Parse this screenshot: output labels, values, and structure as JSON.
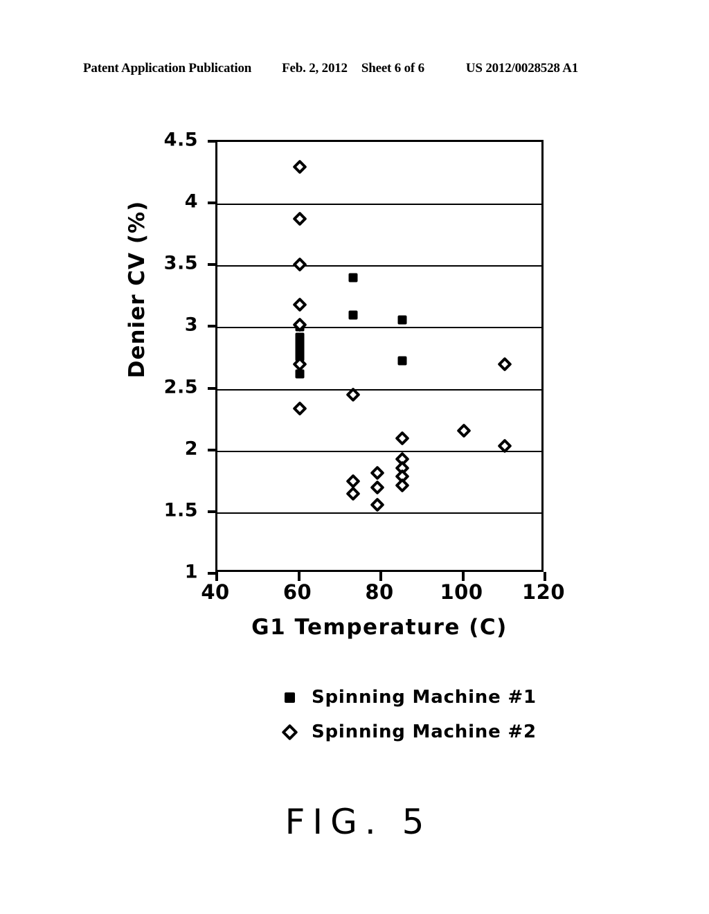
{
  "header": {
    "publication": "Patent Application Publication",
    "date": "Feb. 2, 2012",
    "sheet": "Sheet 6 of 6",
    "patent_number": "US 2012/0028528 A1"
  },
  "figure": {
    "caption": "FIG. 5"
  },
  "chart_data": {
    "type": "scatter",
    "title": "",
    "xlabel": "G1 Temperature (C)",
    "ylabel": "Denier CV (%)",
    "xlim": [
      40,
      120
    ],
    "ylim": [
      1,
      4.5
    ],
    "xticks": [
      "40",
      "60",
      "80",
      "100",
      "120"
    ],
    "xtick_values": [
      40,
      60,
      80,
      100,
      120
    ],
    "yticks": [
      "1",
      "1.5",
      "2",
      "2.5",
      "3",
      "3.5",
      "4",
      "4.5"
    ],
    "ytick_values": [
      1,
      1.5,
      2,
      2.5,
      3,
      3.5,
      4,
      4.5
    ],
    "grid": "horizontal",
    "legend_position": "below",
    "series": [
      {
        "name": "Spinning Machine #1",
        "marker": "filled-square",
        "points": [
          [
            73,
            3.4
          ],
          [
            73,
            3.1
          ],
          [
            85,
            3.06
          ],
          [
            60,
            3.0
          ],
          [
            60,
            2.92
          ],
          [
            60,
            2.88
          ],
          [
            60,
            2.84
          ],
          [
            60,
            2.8
          ],
          [
            60,
            2.76
          ],
          [
            60,
            2.62
          ],
          [
            85,
            2.73
          ]
        ]
      },
      {
        "name": "Spinning Machine #2",
        "marker": "open-diamond",
        "points": [
          [
            60,
            4.3
          ],
          [
            60,
            3.88
          ],
          [
            60,
            3.51
          ],
          [
            60,
            3.18
          ],
          [
            60,
            3.02
          ],
          [
            60,
            2.7
          ],
          [
            60,
            2.34
          ],
          [
            73,
            2.45
          ],
          [
            85,
            2.1
          ],
          [
            100,
            2.16
          ],
          [
            110,
            2.7
          ],
          [
            110,
            2.04
          ],
          [
            73,
            1.75
          ],
          [
            73,
            1.65
          ],
          [
            79,
            1.82
          ],
          [
            79,
            1.7
          ],
          [
            79,
            1.56
          ],
          [
            85,
            1.93
          ],
          [
            85,
            1.86
          ],
          [
            85,
            1.79
          ],
          [
            85,
            1.72
          ]
        ]
      }
    ]
  },
  "legend": {
    "items": [
      {
        "label": "Spinning Machine #1",
        "marker": "filled-square"
      },
      {
        "label": "Spinning Machine #2",
        "marker": "open-diamond"
      }
    ]
  }
}
